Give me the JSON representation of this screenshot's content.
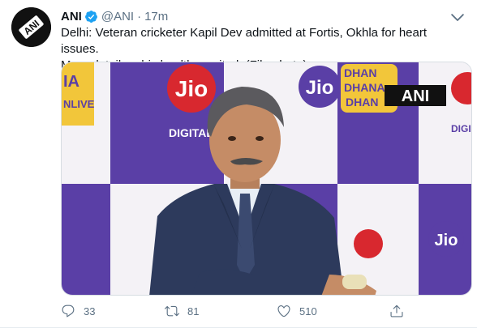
{
  "tweet": {
    "author_name": "ANI",
    "handle": "@ANI",
    "separator": "·",
    "time": "17m",
    "text_line1": "Delhi: Veteran cricketer Kapil Dev admitted at Fortis, Okhla for heart issues.",
    "text_line2": "More detail on his health awaited. (File photo)",
    "verified": true
  },
  "media": {
    "backdrop_texts": {
      "jio": "Jio",
      "digital": "DIGITAL",
      "dhan1": "DHAN",
      "dhan2": "DHANA",
      "dhan3": "DHAN",
      "left_top": "IA",
      "left_bottom": "NLIVE",
      "digi_right": "DIGI",
      "right_fragment": "Jio",
      "watermark": "ANI"
    },
    "colors": {
      "purple": "#5a3fa6",
      "white_panel": "#f4f2f6",
      "jio_red": "#d8282f",
      "yellow": "#f2c63a"
    }
  },
  "actions": {
    "reply_count": "33",
    "retweet_count": "81",
    "like_count": "510"
  },
  "icons": {
    "avatar": "ani-logo-avatar",
    "verified": "verified-badge-icon",
    "caret": "chevron-down-icon",
    "reply": "reply-icon",
    "retweet": "retweet-icon",
    "like": "heart-icon",
    "share": "share-icon"
  },
  "theme": {
    "accent": "#1da1f2",
    "muted": "#5b7083"
  }
}
